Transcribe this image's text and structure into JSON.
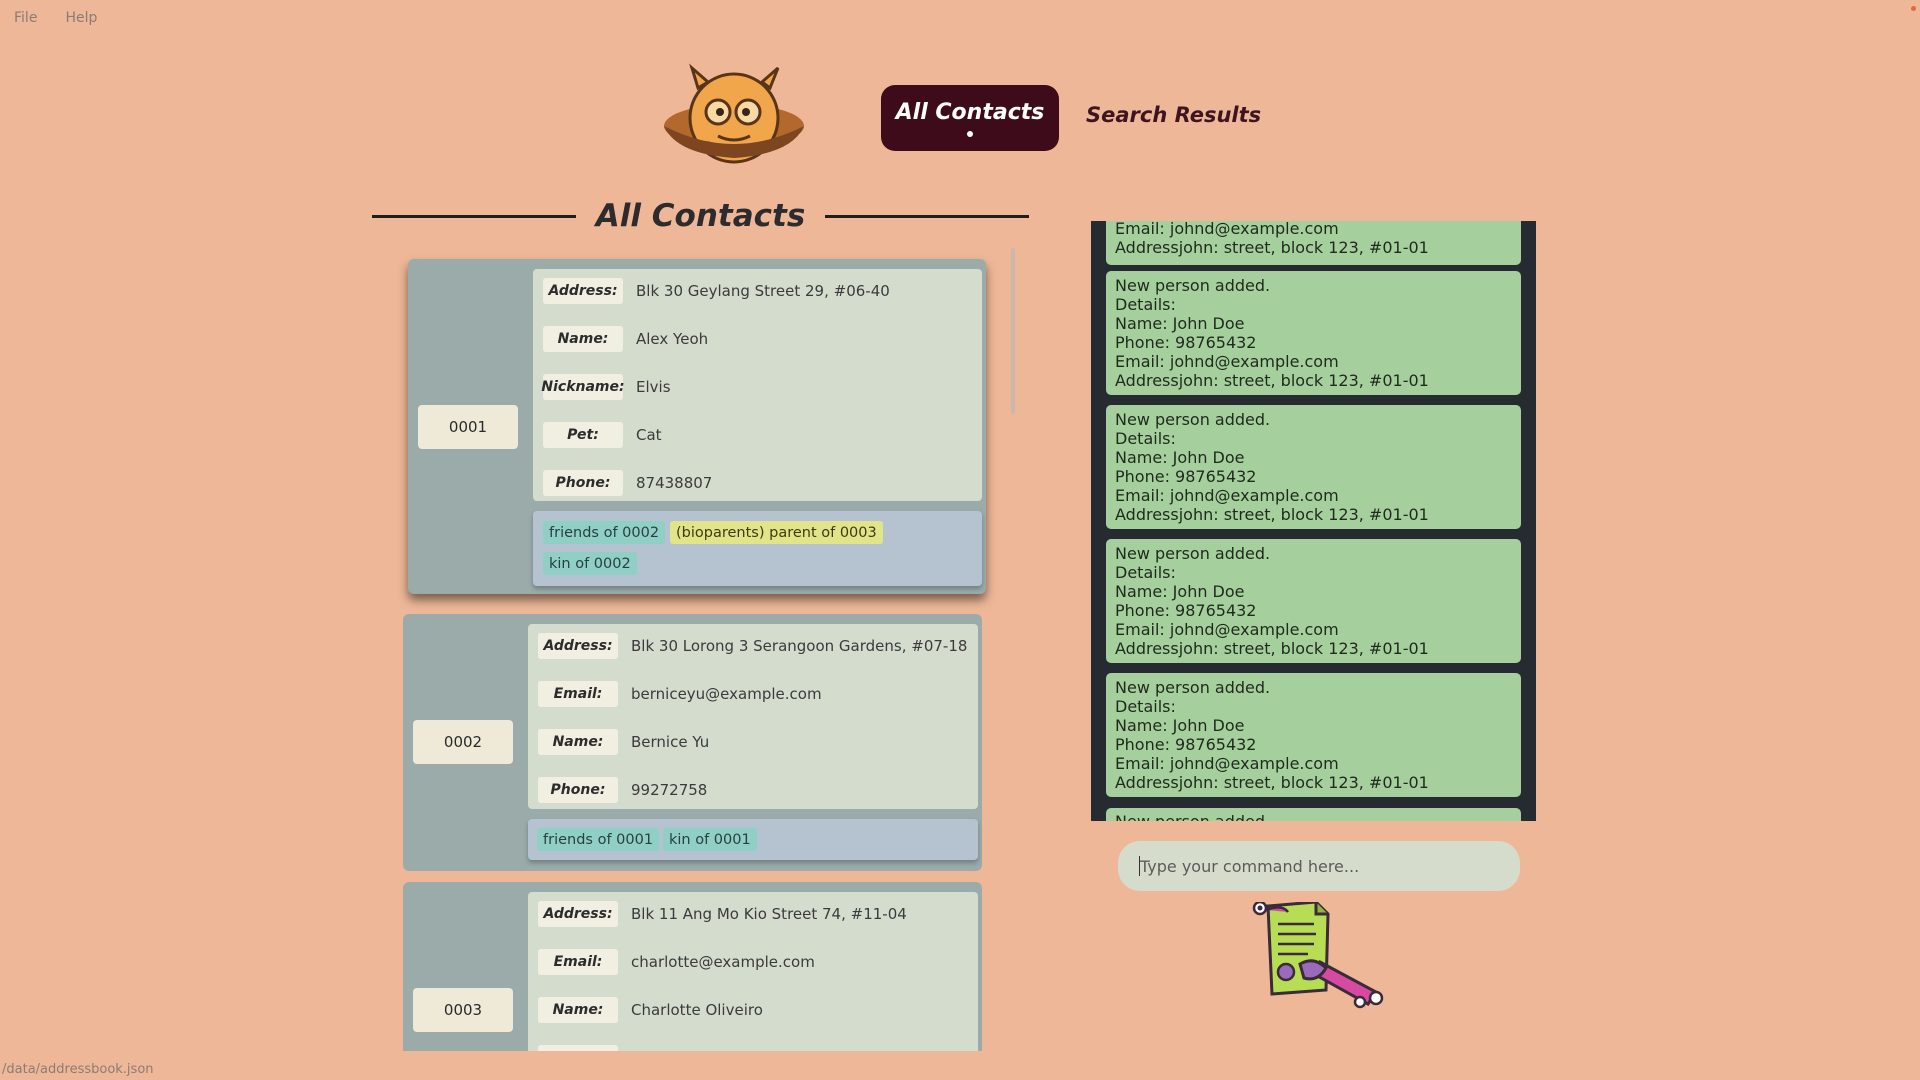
{
  "menu": [
    "File",
    "Help"
  ],
  "tabs": {
    "all": "All Contacts",
    "search": "Search Results"
  },
  "section_title": "All Contacts",
  "contacts": [
    {
      "id": "0001",
      "fields": [
        {
          "label": "Address:",
          "value": "Blk 30 Geylang Street 29, #06-40"
        },
        {
          "label": "Name:",
          "value": "Alex Yeoh"
        },
        {
          "label": "Nickname:",
          "value": "Elvis"
        },
        {
          "label": "Pet:",
          "value": "Cat"
        },
        {
          "label": "Phone:",
          "value": "87438807"
        }
      ],
      "tags": [
        "friends of 0002",
        "(bioparents) parent of 0003",
        "kin of 0002"
      ]
    },
    {
      "id": "0002",
      "fields": [
        {
          "label": "Address:",
          "value": "Blk 30 Lorong 3 Serangoon Gardens, #07-18"
        },
        {
          "label": "Email:",
          "value": "berniceyu@example.com"
        },
        {
          "label": "Name:",
          "value": "Bernice Yu"
        },
        {
          "label": "Phone:",
          "value": "99272758"
        }
      ],
      "tags": [
        "friends of 0001",
        "kin of 0001"
      ]
    },
    {
      "id": "0003",
      "fields": [
        {
          "label": "Address:",
          "value": "Blk 11 Ang Mo Kio Street 74, #11-04"
        },
        {
          "label": "Email:",
          "value": "charlotte@example.com"
        },
        {
          "label": "Name:",
          "value": "Charlotte Oliveiro"
        }
      ],
      "tags": []
    }
  ],
  "results": {
    "partial_top": [
      "Email: johnd@example.com",
      "Addressjohn: street, block 123, #01-01"
    ],
    "message": [
      "New person added.",
      "Details:",
      "Name: John Doe",
      "Phone: 98765432",
      "Email: johnd@example.com",
      "Addressjohn: street, block 123, #01-01"
    ],
    "partial_bottom": "New person added."
  },
  "command": {
    "placeholder": "Type your command here..."
  },
  "status_path": "/data/addressbook.json"
}
